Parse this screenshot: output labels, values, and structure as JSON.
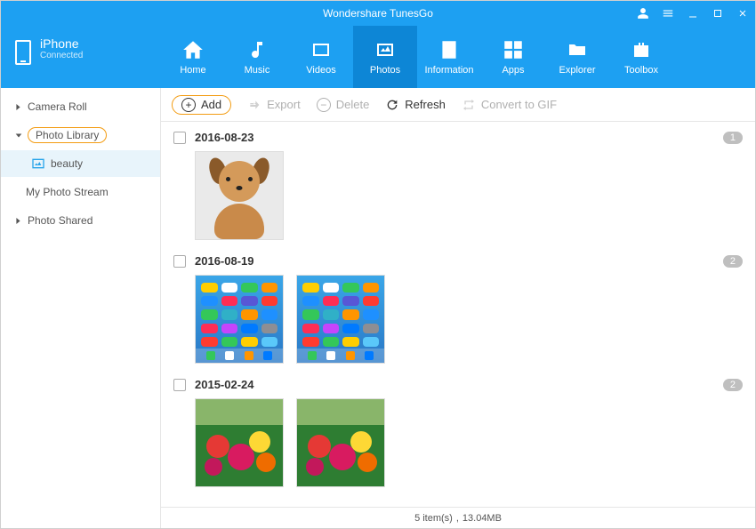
{
  "app": {
    "title": "Wondershare TunesGo"
  },
  "device": {
    "name": "iPhone",
    "status": "Connected"
  },
  "nav": {
    "tabs": [
      {
        "label": "Home"
      },
      {
        "label": "Music"
      },
      {
        "label": "Videos"
      },
      {
        "label": "Photos"
      },
      {
        "label": "Information"
      },
      {
        "label": "Apps"
      },
      {
        "label": "Explorer"
      },
      {
        "label": "Toolbox"
      }
    ],
    "activeIndex": 3
  },
  "sidebar": {
    "items": [
      {
        "label": "Camera Roll"
      },
      {
        "label": "Photo Library"
      },
      {
        "label": "My Photo Stream"
      },
      {
        "label": "Photo Shared"
      }
    ],
    "sub": {
      "label": "beauty"
    }
  },
  "toolbar": {
    "add": "Add",
    "export": "Export",
    "delete": "Delete",
    "refresh": "Refresh",
    "gif": "Convert to GIF"
  },
  "groups": [
    {
      "date": "2016-08-23",
      "count": "1"
    },
    {
      "date": "2016-08-19",
      "count": "2"
    },
    {
      "date": "2015-02-24",
      "count": "2"
    }
  ],
  "status": {
    "count": "5 item(s)",
    "size": "13.04MB"
  }
}
